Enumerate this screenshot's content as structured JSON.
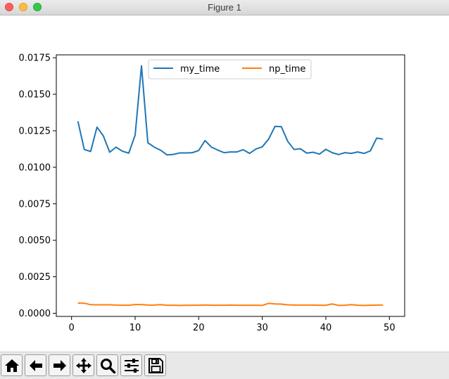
{
  "window": {
    "title": "Figure 1",
    "traffic_lights": [
      {
        "name": "close-button",
        "color": "#fc615d",
        "border": "#de4a45"
      },
      {
        "name": "minimize-button",
        "color": "#fdbc40",
        "border": "#dea133"
      },
      {
        "name": "zoom-button",
        "color": "#34c84a",
        "border": "#27a838"
      }
    ]
  },
  "toolbar": {
    "buttons": [
      {
        "name": "home-button",
        "icon": "home-icon"
      },
      {
        "name": "back-button",
        "icon": "arrow-left-icon"
      },
      {
        "name": "forward-button",
        "icon": "arrow-right-icon"
      },
      {
        "name": "pan-button",
        "icon": "move-icon"
      },
      {
        "name": "zoom-tool-button",
        "icon": "magnifier-icon"
      },
      {
        "name": "configure-subplots-button",
        "icon": "sliders-icon"
      },
      {
        "name": "save-button",
        "icon": "floppy-disk-icon"
      }
    ]
  },
  "chart_data": {
    "type": "line",
    "title": "",
    "xlabel": "",
    "ylabel": "",
    "xlim": [
      -2.4,
      52.4
    ],
    "ylim": [
      -0.000215,
      0.0177
    ],
    "xticks": [
      0,
      10,
      20,
      30,
      40,
      50
    ],
    "xtick_labels": [
      "0",
      "10",
      "20",
      "30",
      "40",
      "50"
    ],
    "yticks": [
      0,
      0.0025,
      0.005,
      0.0075,
      0.01,
      0.0125,
      0.015,
      0.0175
    ],
    "ytick_labels": [
      "0.0000",
      "0.0025",
      "0.0050",
      "0.0075",
      "0.0100",
      "0.0125",
      "0.0150",
      "0.0175"
    ],
    "grid": false,
    "legend": {
      "position": "upper-center",
      "ncol": 2
    },
    "x": [
      1,
      2,
      3,
      4,
      5,
      6,
      7,
      8,
      9,
      10,
      11,
      12,
      13,
      14,
      15,
      16,
      17,
      18,
      19,
      20,
      21,
      22,
      23,
      24,
      25,
      26,
      27,
      28,
      29,
      30,
      31,
      32,
      33,
      34,
      35,
      36,
      37,
      38,
      39,
      40,
      41,
      42,
      43,
      44,
      45,
      46,
      47,
      48,
      49
    ],
    "series": [
      {
        "name": "my_time",
        "color": "#1f77b4",
        "values": [
          0.01315,
          0.01122,
          0.01108,
          0.01275,
          0.01215,
          0.01103,
          0.01138,
          0.0111,
          0.01097,
          0.0122,
          0.01695,
          0.01168,
          0.01138,
          0.01117,
          0.01085,
          0.01088,
          0.01098,
          0.01098,
          0.011,
          0.01115,
          0.01183,
          0.01138,
          0.01118,
          0.011,
          0.01105,
          0.01105,
          0.0112,
          0.01095,
          0.01125,
          0.0114,
          0.01193,
          0.0128,
          0.01278,
          0.01178,
          0.01122,
          0.01127,
          0.01097,
          0.01103,
          0.0109,
          0.01123,
          0.011,
          0.01087,
          0.011,
          0.01095,
          0.01105,
          0.01095,
          0.01112,
          0.012,
          0.01193
        ]
      },
      {
        "name": "np_time",
        "color": "#ff7f0e",
        "values": [
          0.0007,
          0.00069,
          0.00059,
          0.00058,
          0.00058,
          0.00058,
          0.00056,
          0.00055,
          0.00055,
          0.0006,
          0.0006,
          0.00056,
          0.00056,
          0.00059,
          0.00055,
          0.00055,
          0.00054,
          0.00055,
          0.00055,
          0.00055,
          0.00057,
          0.00055,
          0.00055,
          0.00055,
          0.00056,
          0.00055,
          0.00055,
          0.00055,
          0.00055,
          0.00054,
          0.00068,
          0.00064,
          0.00063,
          0.00058,
          0.00056,
          0.00056,
          0.00056,
          0.00056,
          0.00055,
          0.00055,
          0.00064,
          0.00054,
          0.00055,
          0.00059,
          0.00055,
          0.00054,
          0.00055,
          0.00056,
          0.00056
        ]
      }
    ]
  }
}
